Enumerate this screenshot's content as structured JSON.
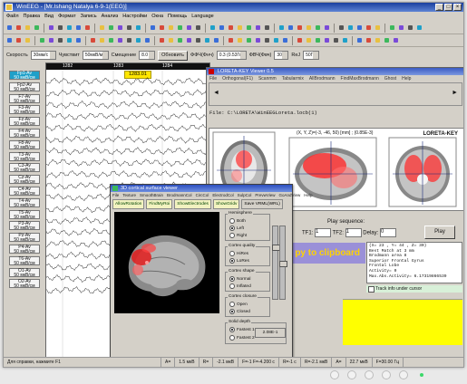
{
  "window": {
    "title": "WinEEG - [Mr.Ishang Natalya 6-9-1(EEG)]",
    "menu": [
      "Файл",
      "Правка",
      "Вид",
      "Формат",
      "Запись",
      "Анализ",
      "Настройки",
      "Окна",
      "Помощь",
      "Language"
    ]
  },
  "params": {
    "speed_label": "Скорость",
    "speed_value": "30мм/с",
    "sens_label": "Чувствит",
    "sens_value": "50мкВ/мм",
    "shift_label": "Смещение",
    "shift_value": "8.0",
    "apply_label": "Обновить",
    "ffch_label": "ФФЧ(Фнч)",
    "ffch_value": "0.3 (0.53Гц)",
    "fvch_label": "ФВЧ(Фвч)",
    "fvch_value": "30",
    "rej_label": "ReJ",
    "rej_value": "50Гц"
  },
  "channels": [
    {
      "name": "Fp1-Av",
      "sens": "50 мкВ/см",
      "selected": true
    },
    {
      "name": "Fp2-Av",
      "sens": "50 мкВ/см"
    },
    {
      "name": "F7-Av",
      "sens": "50 мкВ/см"
    },
    {
      "name": "F3-Av",
      "sens": "50 мкВ/см"
    },
    {
      "name": "Fz-Av",
      "sens": "50 мкВ/см"
    },
    {
      "name": "F4-Av",
      "sens": "50 мкВ/см"
    },
    {
      "name": "F8-Av",
      "sens": "50 мкВ/см"
    },
    {
      "name": "T3-Av",
      "sens": "50 мкВ/см"
    },
    {
      "name": "C3-Av",
      "sens": "50 мкВ/см"
    },
    {
      "name": "Cz-Av",
      "sens": "50 мкВ/см"
    },
    {
      "name": "C4-Av",
      "sens": "50 мкВ/см"
    },
    {
      "name": "T4-Av",
      "sens": "50 мкВ/см"
    },
    {
      "name": "T5-Av",
      "sens": "50 мкВ/см"
    },
    {
      "name": "P3-Av",
      "sens": "50 мкВ/см"
    },
    {
      "name": "Pz-Av",
      "sens": "50 мкВ/см"
    },
    {
      "name": "P4-Av",
      "sens": "50 мкВ/см"
    },
    {
      "name": "T6-Av",
      "sens": "50 мкВ/см"
    },
    {
      "name": "O1-Av",
      "sens": "50 мкВ/см"
    },
    {
      "name": "O2-Av",
      "sens": "50 мкВ/см"
    }
  ],
  "eeg": {
    "time_marks": [
      "1282",
      "1283",
      "1284"
    ],
    "cursor_time": "1283.01"
  },
  "loreta": {
    "title": "LORETA-KEY Viewer 0.5",
    "menu": [
      "File",
      "Orthogonal(F1)",
      "Scanmm",
      "Tabularmix",
      "AllBrodmann",
      "FindMaxBrodmann",
      "Ghost",
      "Help"
    ],
    "file_path": "File: C:\\LORETA\\WinEEGLoreta.locb(1)",
    "coord_text": "(X, Y, Z)=(-3, -46, 50) [mm] ; (0.85E-3)",
    "key_label": "LORETA-KEY",
    "play_label": "Play sequence:",
    "tf1_label": "TF1:",
    "tf1_value": "1",
    "tf2_label": "TF2:",
    "tf2_value": "1",
    "delay_label": "Delay:",
    "delay_value": "0",
    "play_button": "Play",
    "clipboard_button": "py to clipboard",
    "info_lines": [
      "(X= 23 , Y= 44 , Z= 30)",
      "Best Match at 3 mm",
      "Brodmann area 8",
      "Superior Frontal Gyrus",
      "Frontal Lobe",
      "Activity= 0",
      "Max.Abs.Activity= 6.17319866539"
    ],
    "track_label": "Track info under cursor"
  },
  "viewer3d": {
    "title": "3D cortical surface viewer",
    "menu": [
      "File",
      "Texture",
      "SmoothBrain",
      "BrodmannCol",
      "CircCol",
      "ElectrodCol",
      "SulpCol",
      "PrevwView",
      "GoAndView",
      "Help"
    ],
    "tabs": [
      "AllowRotation",
      "FindMyRoi",
      "ShowElectrodes",
      "ShowGridv"
    ],
    "save_button": "Save VRML(WRL)",
    "hemisphere": {
      "title": "Hemisphere",
      "options": [
        "Both",
        "Left",
        "Right"
      ],
      "selected": "Left"
    },
    "quality": {
      "title": "Cortex quality",
      "options": [
        "HiRes",
        "LoRes"
      ],
      "selected": "LoRes"
    },
    "shape": {
      "title": "Cortex shape",
      "options": [
        "Normal",
        "Inflated"
      ],
      "selected": "Normal"
    },
    "closure": {
      "title": "Cortex closure",
      "options": [
        "Open",
        "Closed"
      ],
      "selected": "Closed"
    },
    "depth": {
      "title": "Solid depth",
      "options": [
        "Fastest 1",
        "Fastest 2"
      ],
      "selected": "Fastest 1",
      "value": "2.08E-1"
    }
  },
  "status": {
    "hint": "Для справки, нажмите F1",
    "fields": [
      "A=",
      "1.5 мкВ",
      "R=",
      "-2.1 мкВ",
      "F=-1 F=-4.200 c",
      "R=-1 c",
      "R=-2.1 мкВ",
      "A=",
      "22.7 мкВ",
      "F=30.00 Гц"
    ]
  },
  "colors": {
    "title_bar": "#1a3f9e",
    "selected_channel": "#1fa0c9",
    "cursor_label": "#ffe600",
    "activation": "#e81818",
    "clipboard_bg": "#9a90d8",
    "clipboard_text": "#ffd400",
    "yellow_panel": "#ffff00"
  }
}
